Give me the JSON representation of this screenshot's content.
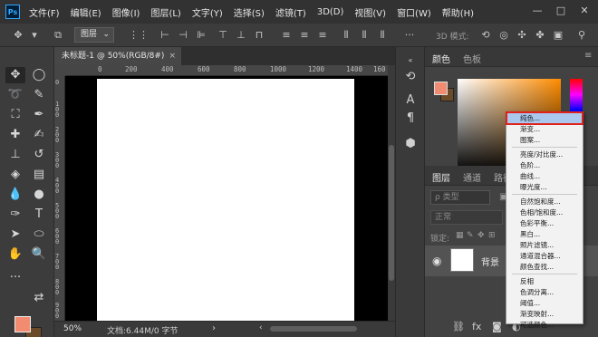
{
  "menubar": {
    "logo": "Ps",
    "items": [
      "文件(F)",
      "编辑(E)",
      "图像(I)",
      "图层(L)",
      "文字(Y)",
      "选择(S)",
      "滤镜(T)",
      "3D(D)",
      "视图(V)",
      "窗口(W)",
      "帮助(H)"
    ],
    "window_controls": [
      "—",
      "□",
      "✕"
    ]
  },
  "options_bar": {
    "layer_select": "图层",
    "mode_3d": "3D 模式:"
  },
  "document": {
    "tab_title": "未标题-1 @ 50%(RGB/8#)",
    "tab_close": "×",
    "ruler_h": [
      "0",
      "200",
      "400",
      "600",
      "800",
      "1000",
      "1200",
      "1400",
      "160"
    ],
    "ruler_v": [
      "0",
      "100",
      "200",
      "300",
      "400",
      "500",
      "600",
      "700",
      "800",
      "900"
    ],
    "zoom": "50%",
    "doc_info": "文档:6.44M/0 字节",
    "status_arrow": "›"
  },
  "panels": {
    "color_tab": "颜色",
    "swatches_tab": "色板",
    "layers_tab": "图层",
    "channels_tab": "通道",
    "paths_tab": "路径",
    "search_placeholder": "ρ 类型",
    "blend_mode": "正常",
    "lock_label": "锁定:",
    "layer_name": "背景",
    "fx_label": "fx"
  },
  "adjustment_menu": {
    "items": [
      "纯色...",
      "渐变...",
      "图案...",
      "亮度/对比度...",
      "色阶...",
      "曲线...",
      "曝光度...",
      "自然饱和度...",
      "色相/饱和度...",
      "色彩平衡...",
      "黑白...",
      "照片滤镜...",
      "通道混合器...",
      "颜色查找...",
      "反相",
      "色调分离...",
      "阈值...",
      "渐变映射...",
      "可选颜色..."
    ],
    "highlighted": "纯色..."
  },
  "colors": {
    "foreground": "#f28c70",
    "background": "#6b4a2a",
    "menu_highlight_outline": "#e0211c"
  },
  "icons": {
    "tools": [
      "move-icon",
      "marquee-icon",
      "lasso-icon",
      "quick-select-icon",
      "crop-icon",
      "eyedropper-icon",
      "healing-icon",
      "brush-icon",
      "stamp-icon",
      "history-brush-icon",
      "eraser-icon",
      "gradient-icon",
      "blur-icon",
      "dodge-icon",
      "pen-icon",
      "type-icon",
      "path-select-icon",
      "ellipse-icon",
      "hand-icon",
      "zoom-icon"
    ]
  }
}
